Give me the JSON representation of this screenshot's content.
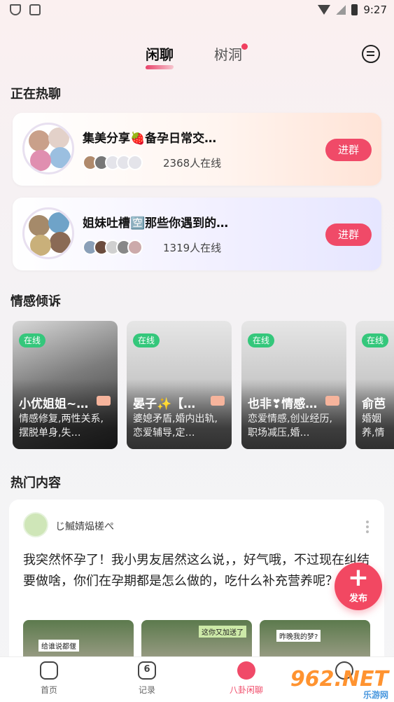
{
  "status_bar": {
    "time": "9:27"
  },
  "header": {
    "tabs": [
      {
        "label": "闲聊",
        "active": true
      },
      {
        "label": "树洞",
        "active": false,
        "has_dot": true
      }
    ]
  },
  "hot_chat": {
    "title": "正在热聊",
    "groups": [
      {
        "name": "集美分享🍓备孕日常交…",
        "online": "2368人在线",
        "join_label": "进群"
      },
      {
        "name": "姐妹吐槽🈳那些你遇到的…",
        "online": "1319人在线",
        "join_label": "进群"
      }
    ]
  },
  "emotion": {
    "title": "情感倾诉",
    "cards": [
      {
        "status": "在线",
        "name": "小优姐姐~…",
        "desc": "情感修复,两性关系,摆脱单身,失…"
      },
      {
        "status": "在线",
        "name": "晏子✨【…",
        "desc": "婆媳矛盾,婚内出轨,恋爱辅导,定…"
      },
      {
        "status": "在线",
        "name": "也非❣情感…",
        "desc": "恋爱情感,创业经历,职场减压,婚…"
      },
      {
        "status": "在线",
        "name": "俞芭",
        "desc": "婚姻养,情"
      }
    ]
  },
  "hot_content": {
    "title": "热门内容",
    "post": {
      "user": "じ鰄婧煰槎ぺ",
      "text": "我突然怀孕了！我小男友居然这么说，，好气哦，不过现在纠结要做啥，你们在孕期都是怎么做的，吃什么补充营养呢？",
      "images": [
        "给谁说都偃",
        "这你又加送了",
        "昨晚我的梦?"
      ]
    }
  },
  "fab": {
    "label": "发布"
  },
  "bottom_nav": {
    "items": [
      {
        "label": "首页",
        "active": false
      },
      {
        "label": "记录",
        "active": false,
        "badge": "6"
      },
      {
        "label": "八卦闲聊",
        "active": true
      },
      {
        "label": "",
        "active": false
      }
    ]
  },
  "watermark": {
    "brand": "962.NET",
    "sub": "乐游网"
  }
}
